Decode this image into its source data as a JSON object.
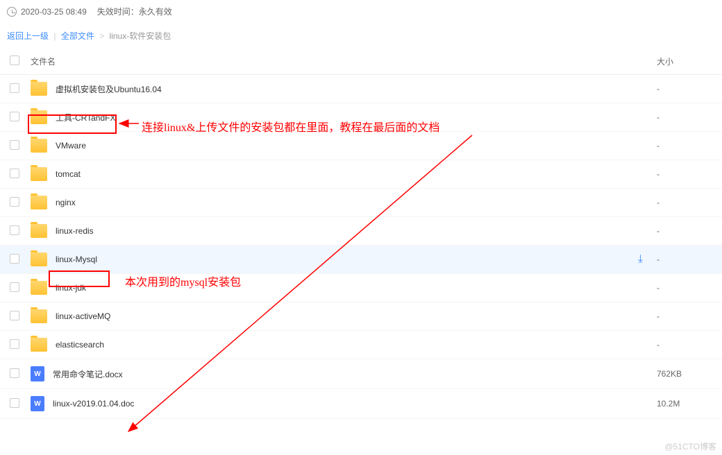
{
  "header": {
    "timestamp": "2020-03-25 08:49",
    "expire_label": "失效时间：",
    "expire_value": "永久有效"
  },
  "breadcrumb": {
    "back": "返回上一级",
    "all_files": "全部文件",
    "current": "linux-软件安装包"
  },
  "columns": {
    "name": "文件名",
    "size": "大小"
  },
  "files": [
    {
      "type": "folder",
      "name": "虚拟机安装包及Ubuntu16.04",
      "size": "-",
      "highlighted": false
    },
    {
      "type": "folder",
      "name": "工具-CRTandFX",
      "size": "-",
      "highlighted": false,
      "boxed": true
    },
    {
      "type": "folder",
      "name": "VMware",
      "size": "-",
      "highlighted": false
    },
    {
      "type": "folder",
      "name": "tomcat",
      "size": "-",
      "highlighted": false
    },
    {
      "type": "folder",
      "name": "nginx",
      "size": "-",
      "highlighted": false
    },
    {
      "type": "folder",
      "name": "linux-redis",
      "size": "-",
      "highlighted": false
    },
    {
      "type": "folder",
      "name": "linux-Mysql",
      "size": "-",
      "highlighted": true,
      "boxed": true,
      "download": true
    },
    {
      "type": "folder",
      "name": "linux-jdk",
      "size": "-",
      "highlighted": false
    },
    {
      "type": "folder",
      "name": "linux-activeMQ",
      "size": "-",
      "highlighted": false
    },
    {
      "type": "folder",
      "name": "elasticsearch",
      "size": "-",
      "highlighted": false
    },
    {
      "type": "doc",
      "name": "常用命令笔记.docx",
      "size": "762KB",
      "highlighted": false
    },
    {
      "type": "doc",
      "name": "linux-v2019.01.04.doc",
      "size": "10.2M",
      "highlighted": false
    }
  ],
  "annotations": {
    "ann1": "连接linux&上传文件的安装包都在里面，教程在最后面的文档",
    "ann2": "本次用到的mysql安装包"
  },
  "doc_letter": "W",
  "watermark": "@51CTO博客"
}
